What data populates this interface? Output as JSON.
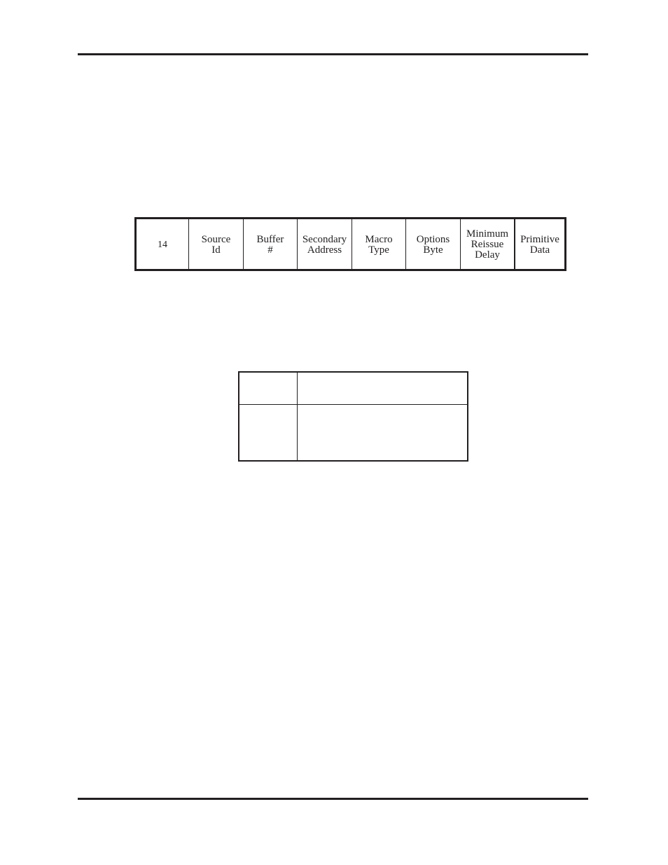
{
  "page": {
    "header_rule": true,
    "footer_rule": true
  },
  "packet_format": {
    "fields": [
      {
        "label": "14"
      },
      {
        "label": "Source\nId"
      },
      {
        "label": "Buffer\n#"
      },
      {
        "label": "Secondary\nAddress"
      },
      {
        "label": "Macro\nType"
      },
      {
        "label": "Options\nByte"
      },
      {
        "label": "Minimum\nReissue\nDelay"
      },
      {
        "label": "Primitive\nData"
      }
    ]
  },
  "empty_table": {
    "rows": [
      {
        "cells": [
          "",
          ""
        ]
      },
      {
        "cells": [
          "",
          ""
        ]
      }
    ]
  }
}
